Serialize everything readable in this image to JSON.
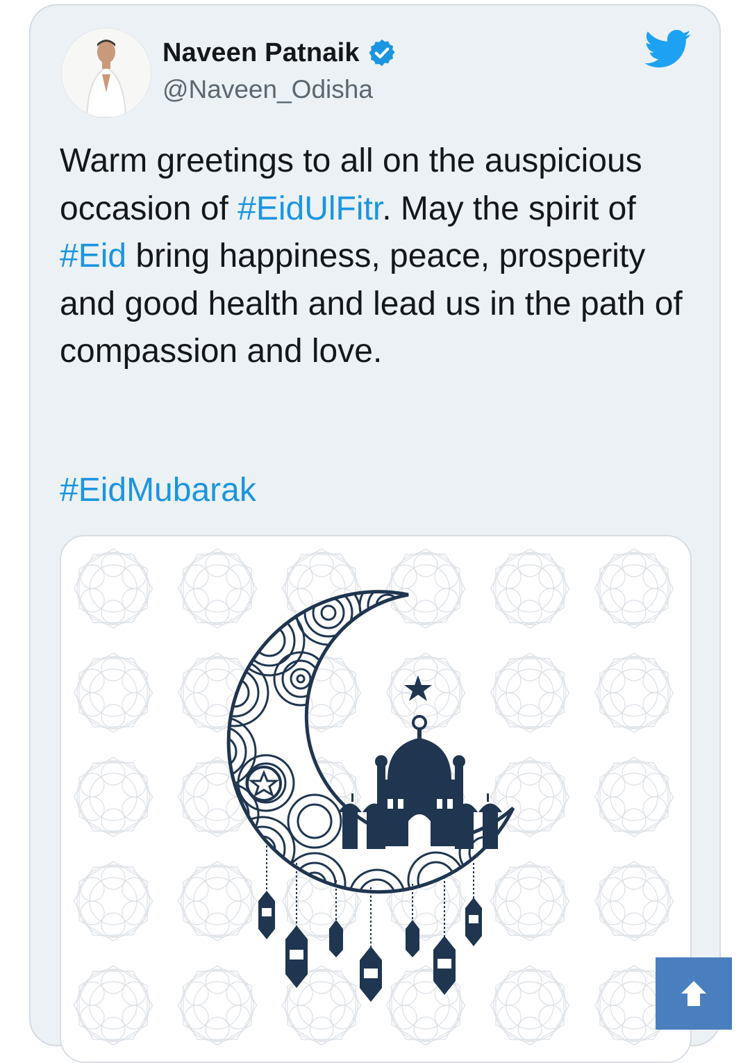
{
  "tweet": {
    "author_name": "Naveen Patnaik",
    "author_handle": "@Naveen_Odisha",
    "text_parts": [
      {
        "text": "Warm greetings to all on the auspicious occasion of ",
        "type": "text"
      },
      {
        "text": "#EidUlFitr",
        "type": "hashtag"
      },
      {
        "text": ". May the spirit of ",
        "type": "text"
      },
      {
        "text": "#Eid",
        "type": "hashtag"
      },
      {
        "text": " bring happiness, peace, prosperity and good health and lead us in the path of compassion and love.",
        "type": "text"
      }
    ],
    "footer_hashtag": "#EidMubarak",
    "verified": true
  },
  "icons": {
    "verified": "verified-badge-icon",
    "brand": "twitter-bird-icon",
    "scroll": "arrow-up-icon"
  },
  "colors": {
    "accent": "#1b95e0",
    "card_background": "#ecf1f5",
    "text": "#14171a",
    "handle": "#5b6770",
    "illustration": "#1f3550",
    "scroll_button": "#4a7fbf"
  }
}
